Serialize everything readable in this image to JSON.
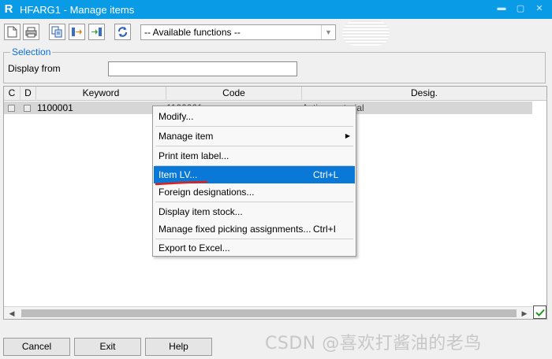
{
  "window": {
    "logo_letter": "R",
    "title": "HFARG1 - Manage items"
  },
  "toolbar": {
    "buttons": [
      "new-icon",
      "print-icon",
      "copy-icon",
      "import-icon",
      "export-icon",
      "refresh-icon"
    ],
    "functions_combo": "-- Available functions --"
  },
  "selection": {
    "legend": "Selection",
    "display_from_label": "Display from",
    "display_from_value": ""
  },
  "grid": {
    "columns": [
      "C",
      "D",
      "Keyword",
      "Code",
      "Desig."
    ],
    "rows": [
      {
        "keyword": "1100001",
        "code": "1100001",
        "desig": "Active material"
      }
    ]
  },
  "context_menu": {
    "items": [
      {
        "label": "Modify...",
        "shortcut": ""
      },
      {
        "label": "Manage item",
        "shortcut": ""
      },
      {
        "label": "Print item label...",
        "shortcut": ""
      },
      {
        "label": "Item LV...",
        "shortcut": "Ctrl+L"
      },
      {
        "label": "Foreign designations...",
        "shortcut": ""
      },
      {
        "label": "Display item stock...",
        "shortcut": ""
      },
      {
        "label": "Manage fixed picking assignments...",
        "shortcut": "Ctrl+I"
      },
      {
        "label": "Export to Excel...",
        "shortcut": ""
      }
    ]
  },
  "footer": {
    "cancel": "Cancel",
    "exit": "Exit",
    "help": "Help"
  },
  "watermark": "CSDN @喜欢打酱油的老鸟",
  "colors": {
    "titlebar": "#0a9be6",
    "menu_highlight": "#0a78d7",
    "legend_text": "#0a6fd8"
  }
}
